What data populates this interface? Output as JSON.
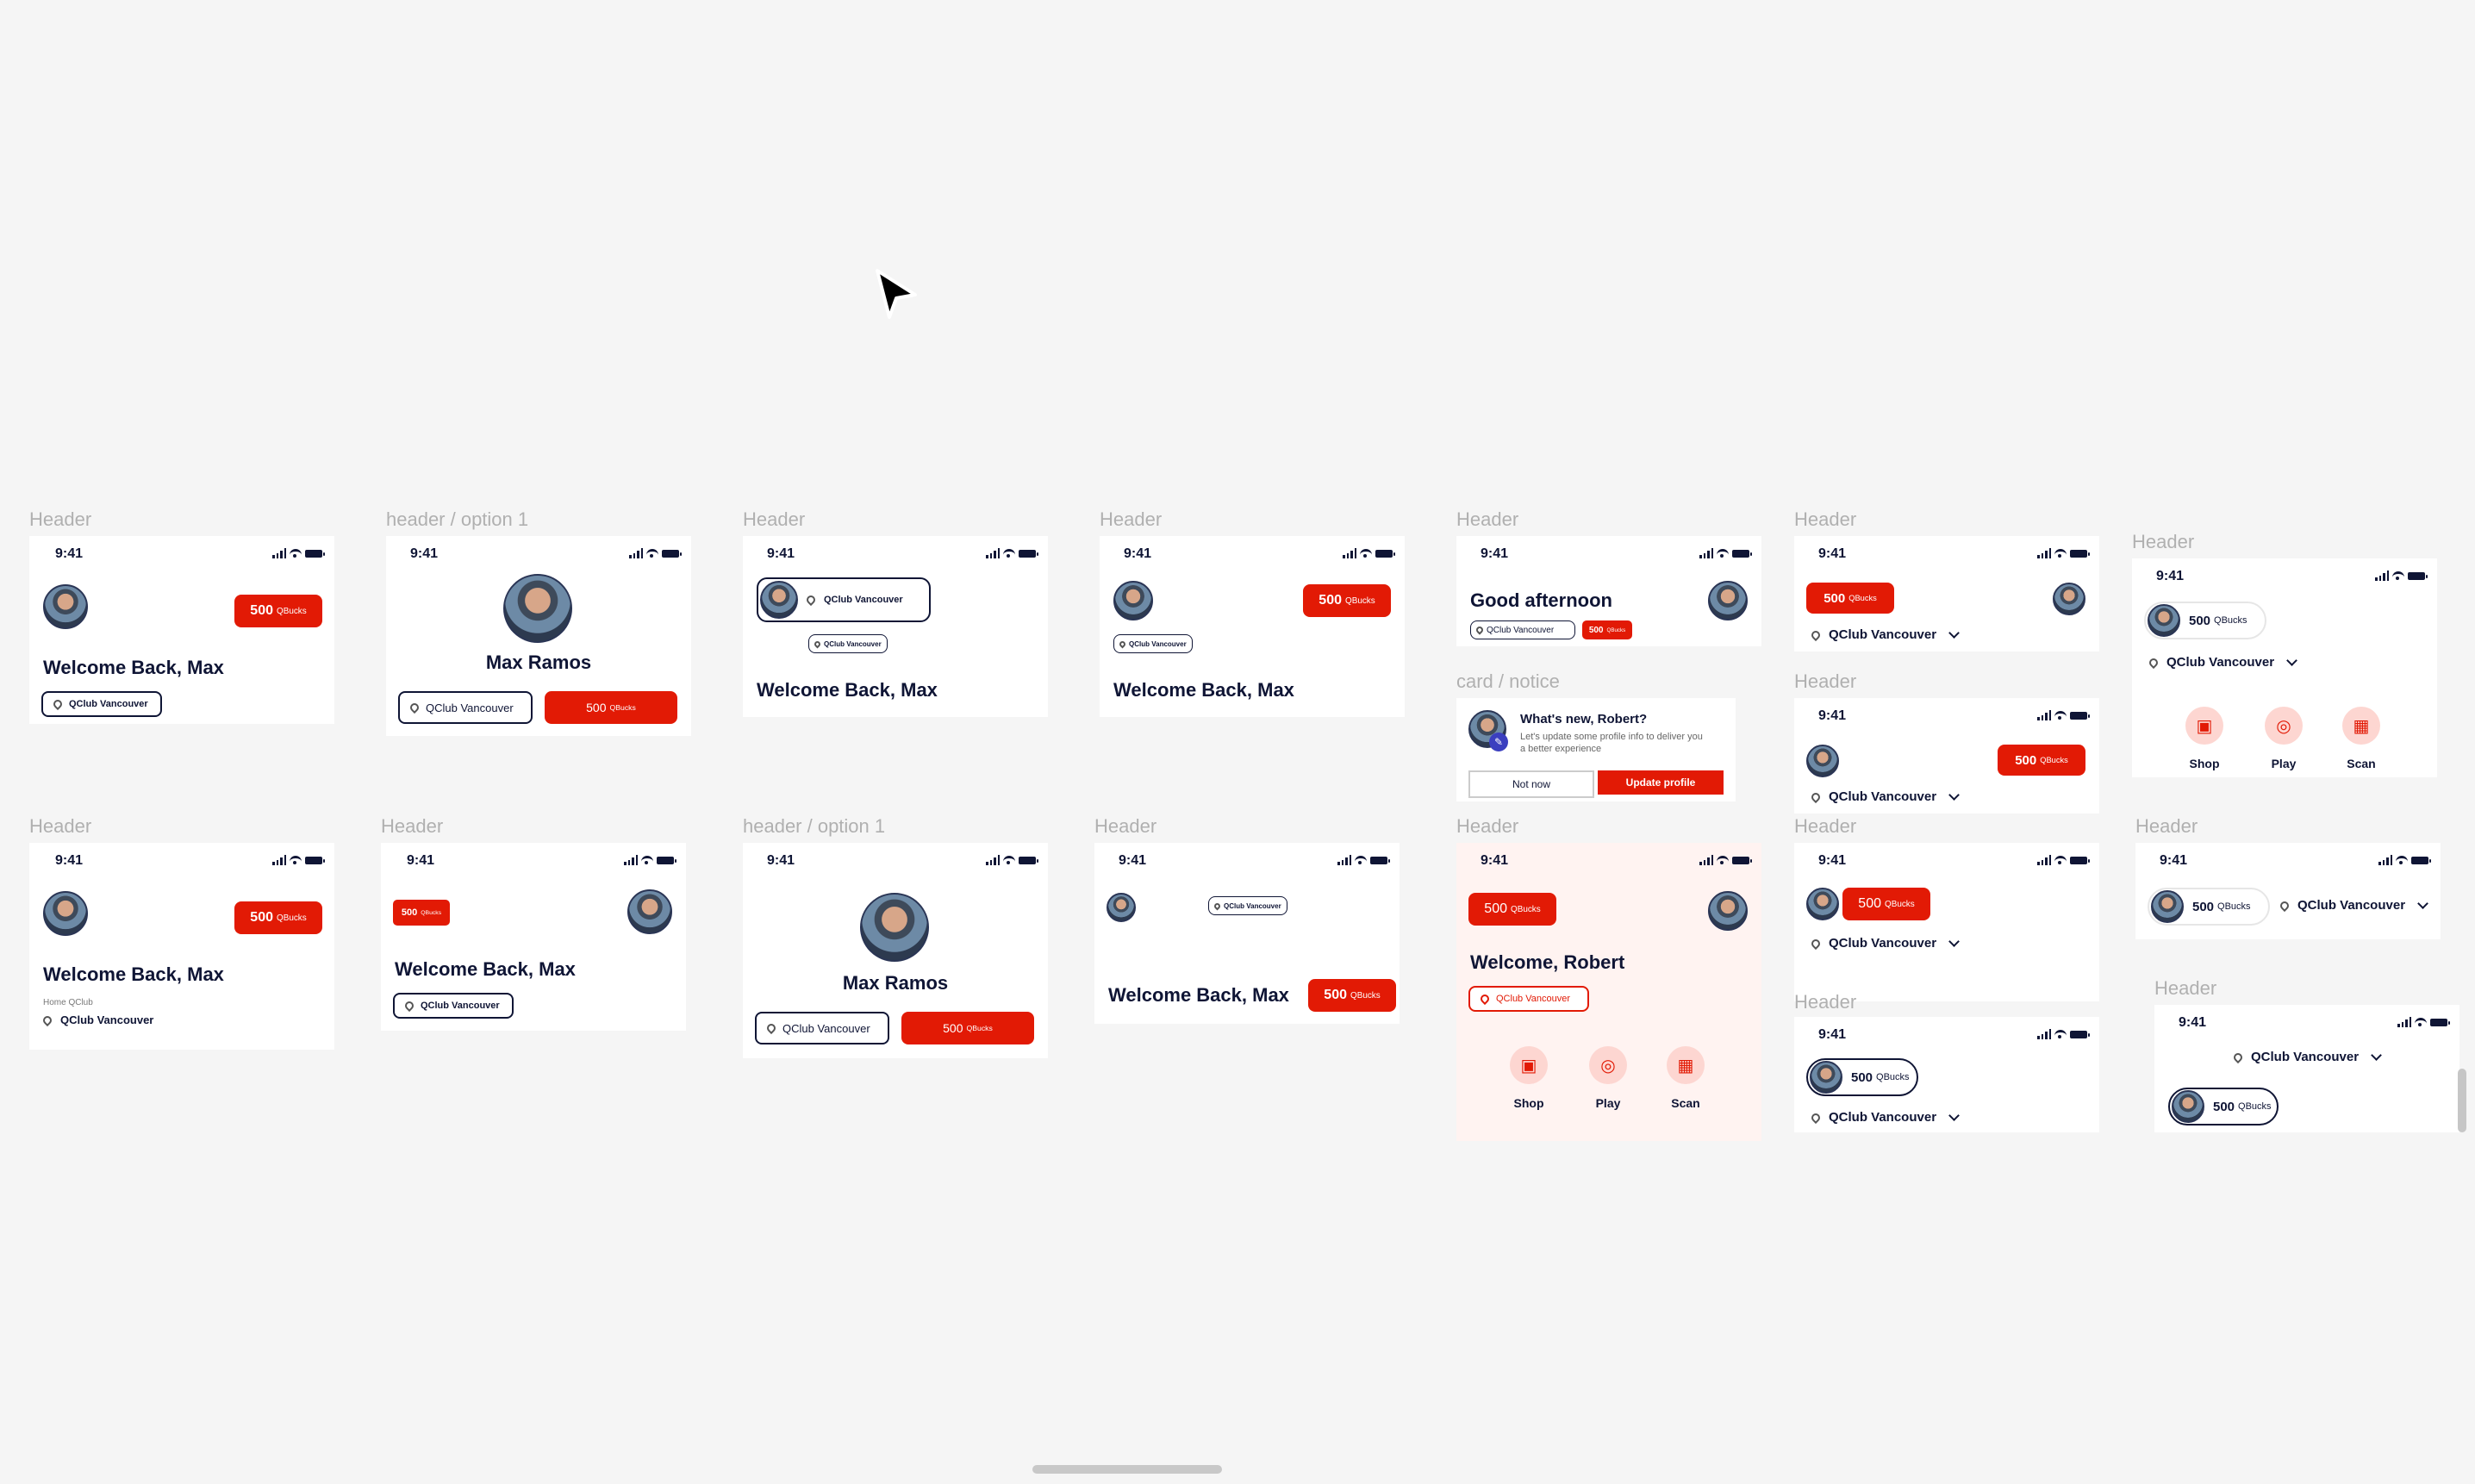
{
  "labels": {
    "header": "Header",
    "header_option_1": "header / option 1",
    "card_notice": "card / notice"
  },
  "status": {
    "time": "9:41"
  },
  "user": {
    "welcome": "Welcome Back, Max",
    "full_name": "Max Ramos",
    "welcome_robert": "Welcome, Robert",
    "good_afternoon": "Good afternoon"
  },
  "location": {
    "name": "QClub Vancouver",
    "home_label": "Home QClub"
  },
  "qbucks": {
    "amount": "500",
    "unit": "QBucks"
  },
  "notice": {
    "title": "What's new, Robert?",
    "body": "Let's update some profile info to deliver you a better experience",
    "dismiss_label": "Not now",
    "confirm_label": "Update profile"
  },
  "actions": {
    "shop": "Shop",
    "play": "Play",
    "scan": "Scan"
  },
  "colors": {
    "accent": "#e21a05",
    "ink": "#0f1535",
    "pink_bg": "#fff3f1"
  },
  "icons": [
    "cursor-arrow-icon",
    "location-pin-icon",
    "chevron-down-icon",
    "shop-bag-icon",
    "gamepad-icon",
    "qr-code-icon",
    "edit-pencil-icon"
  ]
}
